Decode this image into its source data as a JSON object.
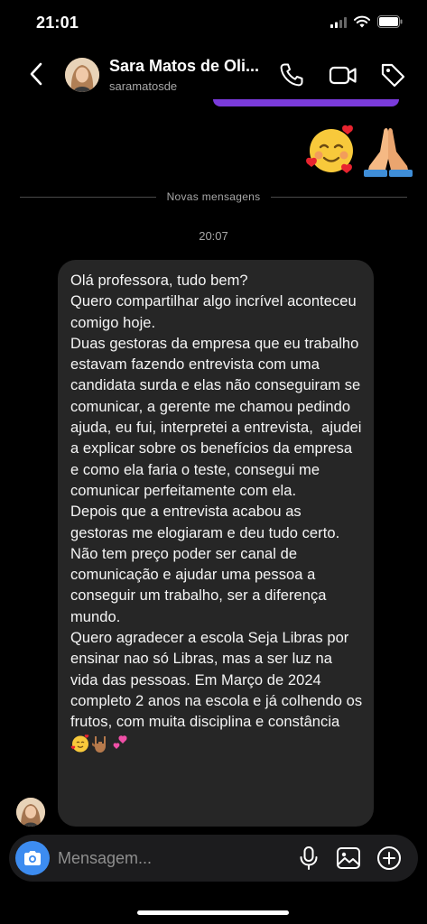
{
  "status_bar": {
    "time": "21:01",
    "signal_icon": "cellular-signal-icon",
    "wifi_icon": "wifi-icon",
    "battery_icon": "battery-icon"
  },
  "header": {
    "contact_name": "Sara Matos de Oli...",
    "username": "saramatosde",
    "back_icon": "chevron-left-icon",
    "call_icon": "phone-icon",
    "video_icon": "video-camera-icon",
    "tag_icon": "tag-icon"
  },
  "thread": {
    "sent_emojis": [
      "smiling-face-with-hearts-emoji",
      "folded-hands-emoji"
    ],
    "divider_label": "Novas mensagens",
    "timestamp": "20:07",
    "received_message": {
      "paragraphs": [
        "Olá professora, tudo bem?",
        "Quero compartilhar algo incrível aconteceu comigo hoje.",
        "Duas gestoras da empresa que eu trabalho estavam fazendo entrevista com uma candidata surda e elas não conseguiram se comunicar, a gerente me chamou pedindo ajuda, eu fui, interpretei a entrevista,  ajudei a explicar sobre os benefícios da empresa e como ela faria o teste, consegui me comunicar perfeitamente com ela.",
        "Depois que a entrevista acabou as gestoras me elogiaram e deu tudo certo.",
        "Não tem preço poder ser canal de comunicação e ajudar uma pessoa a conseguir um trabalho, ser a diferença mundo.",
        "Quero agradecer a escola Seja Libras por ensinar nao só Libras, mas a ser luz na vida das pessoas. Em Março de 2024 completo 2 anos na escola e já colhendo os frutos, com muita disciplina e constância"
      ],
      "trailing_emojis": [
        "smiling-face-with-hearts-emoji",
        "love-you-gesture-emoji",
        "two-hearts-emoji"
      ]
    }
  },
  "composer": {
    "placeholder": "Mensagem...",
    "camera_icon": "camera-icon",
    "mic_icon": "microphone-icon",
    "gallery_icon": "image-gallery-icon",
    "plus_icon": "plus-circle-icon"
  },
  "colors": {
    "background": "#000000",
    "bubble": "#262626",
    "accent": "#3d8cf0",
    "sent_bubble": "#7a3bdb",
    "muted_text": "#a8a8a8"
  }
}
